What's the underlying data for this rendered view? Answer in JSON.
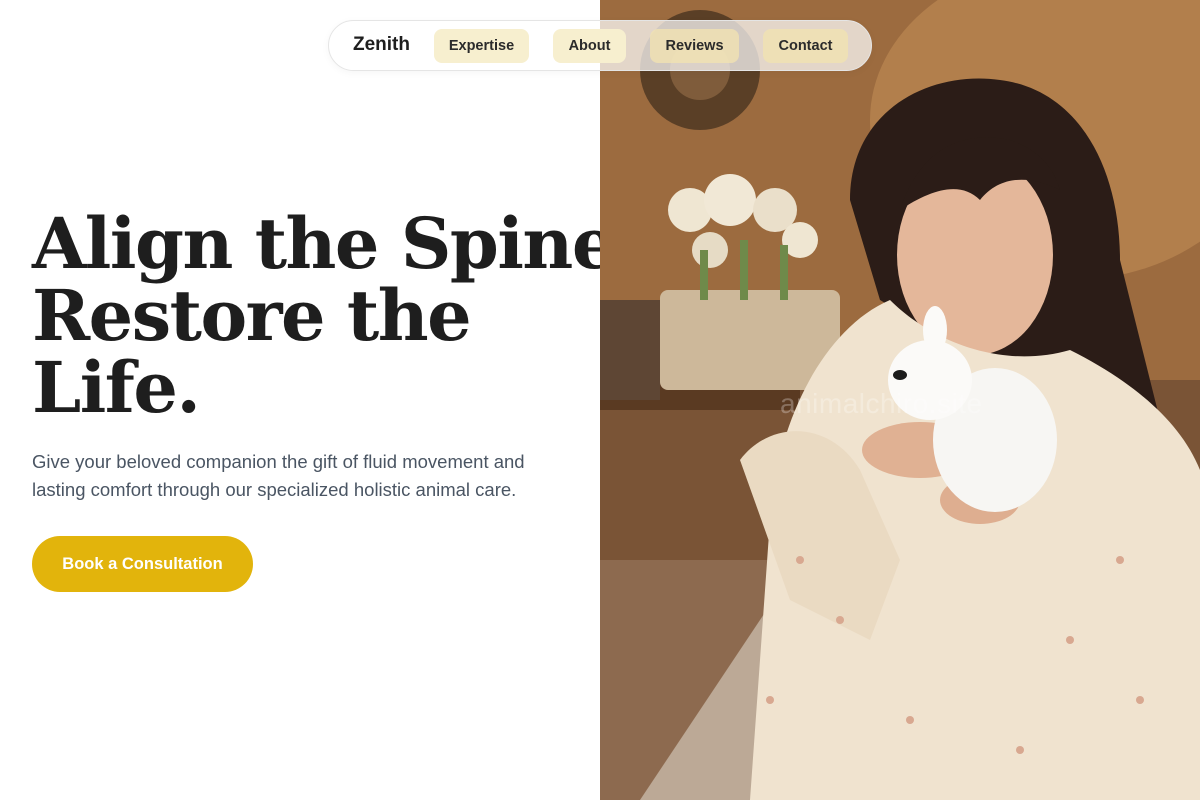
{
  "nav": {
    "brand": "Zenith",
    "links": [
      {
        "label": "Expertise"
      },
      {
        "label": "About"
      },
      {
        "label": "Reviews"
      },
      {
        "label": "Contact"
      }
    ]
  },
  "hero": {
    "title_lines": [
      "Align the Spine,",
      "Restore the",
      "Life."
    ],
    "subtitle": "Give your beloved companion the gift of fluid movement and lasting comfort through our specialized holistic animal care.",
    "cta_label": "Book a Consultation"
  },
  "photo": {
    "watermark": "animalchiro.site"
  },
  "colors": {
    "accent": "#e2b40c",
    "nav_link_bg": "#f7efcf",
    "title_text": "#1e1e1e",
    "body_text": "#4a5563"
  }
}
